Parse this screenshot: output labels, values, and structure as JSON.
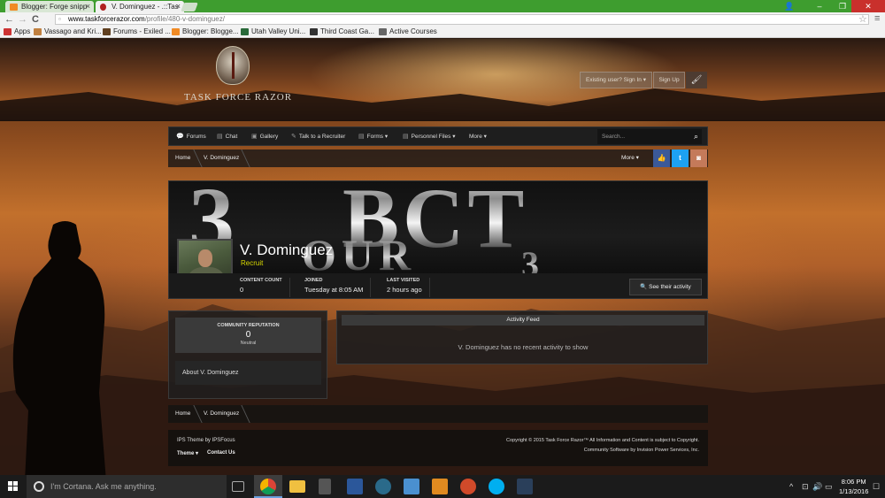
{
  "browser": {
    "tabs": [
      {
        "label": "Blogger: Forge snipp",
        "close": "×"
      },
      {
        "label": "V. Dominguez - .::Tas",
        "close": "×"
      }
    ],
    "window_controls": {
      "user": "👤",
      "minimize": "–",
      "maximize": "❐",
      "close": "✕"
    },
    "nav": {
      "back": "←",
      "forward": "→",
      "reload": "C"
    },
    "url_host": "www.taskforcerazor.com",
    "url_path": "/profile/480-v-dominguez/",
    "bookmarks": [
      {
        "label": "Apps",
        "color": "#cc3333"
      },
      {
        "label": "Vassago and Kri...",
        "color": "#c08040"
      },
      {
        "label": "Forums - Exiled ...",
        "color": "#604020"
      },
      {
        "label": "Blogger: Blogge...",
        "color": "#f08a24"
      },
      {
        "label": "Utah Valley Uni...",
        "color": "#2a6a3a"
      },
      {
        "label": "Third Coast Ga...",
        "color": "#333333"
      },
      {
        "label": "Active Courses",
        "color": "#666666"
      }
    ]
  },
  "site": {
    "logo_text": "TASK FORCE RAZOR",
    "sign_in": "Existing user? Sign In ▾",
    "sign_up": "Sign Up",
    "brush_icon": "🖌",
    "nav": [
      {
        "icon": "comments-icon",
        "glyph": "💬",
        "label": "Forums"
      },
      {
        "icon": "chat-icon",
        "glyph": "▤",
        "label": "Chat"
      },
      {
        "icon": "gallery-icon",
        "glyph": "▣",
        "label": "Gallery"
      },
      {
        "icon": "recruiter-icon",
        "glyph": "✎",
        "label": "Talk to a Recruiter"
      },
      {
        "icon": "forms-icon",
        "glyph": "▤",
        "label": "Forms ▾"
      },
      {
        "icon": "files-icon",
        "glyph": "▤",
        "label": "Personnel Files ▾"
      },
      {
        "icon": "",
        "glyph": "",
        "label": "More ▾"
      }
    ],
    "search_placeholder": "Search...",
    "breadcrumb": [
      "Home",
      "V. Dominguez"
    ],
    "more_menu": "More ▾",
    "social": [
      {
        "name": "facebook-icon",
        "glyph": "👍",
        "color": "#3b5998"
      },
      {
        "name": "twitter-icon",
        "glyph": "t",
        "color": "#1da1f2"
      },
      {
        "name": "instagram-icon",
        "glyph": "◙",
        "color": "#c47a5a"
      }
    ]
  },
  "profile": {
    "cover_text": [
      "3",
      "BCT",
      "OUR",
      "3"
    ],
    "name": "V. Dominguez",
    "rank": "Recruit",
    "rank_color": "#d8d800",
    "stats": [
      {
        "label": "CONTENT COUNT",
        "value": "0"
      },
      {
        "label": "JOINED",
        "value": "Tuesday at 8:05 AM"
      },
      {
        "label": "LAST VISITED",
        "value": "2 hours ago"
      }
    ],
    "activity_button": "🔍 See their activity",
    "reputation_label": "COMMUNITY REPUTATION",
    "reputation_value": "0",
    "reputation_status": "Neutral",
    "about": "About V. Dominguez",
    "feed_title": "Activity Feed",
    "feed_empty": "V. Dominguez has no recent activity to show"
  },
  "footer": {
    "theme_credit": "IPS Theme by IPSFocus",
    "theme_link": "Theme ▾",
    "contact_link": "Contact Us",
    "copyright": "Copyright © 2015 Task Force Razor™ All Information and Content is subject to Copyright.",
    "software": "Community Software by Invision Power Services, Inc."
  },
  "taskbar": {
    "cortana": "I'm Cortana. Ask me anything.",
    "apps": [
      {
        "name": "task-view-icon",
        "color": "#444444"
      },
      {
        "name": "chrome-icon",
        "color": "#3cba54"
      },
      {
        "name": "file-explorer-icon",
        "color": "#f0c040"
      },
      {
        "name": "calculator-icon",
        "color": "#555555"
      },
      {
        "name": "word-icon",
        "color": "#2b579a"
      },
      {
        "name": "app-icon-swirl",
        "color": "#2a6a8a"
      },
      {
        "name": "app-icon-blue",
        "color": "#4a90d0"
      },
      {
        "name": "media-player-icon",
        "color": "#e08a20"
      },
      {
        "name": "app-icon-red",
        "color": "#d04a2a"
      },
      {
        "name": "skype-icon",
        "color": "#00aff0"
      },
      {
        "name": "steam-icon",
        "color": "#2a3f5a"
      }
    ],
    "tray": [
      "^",
      "⊡",
      "🔊",
      "▭",
      "☐"
    ],
    "time": "8:06 PM",
    "date": "1/13/2016"
  }
}
